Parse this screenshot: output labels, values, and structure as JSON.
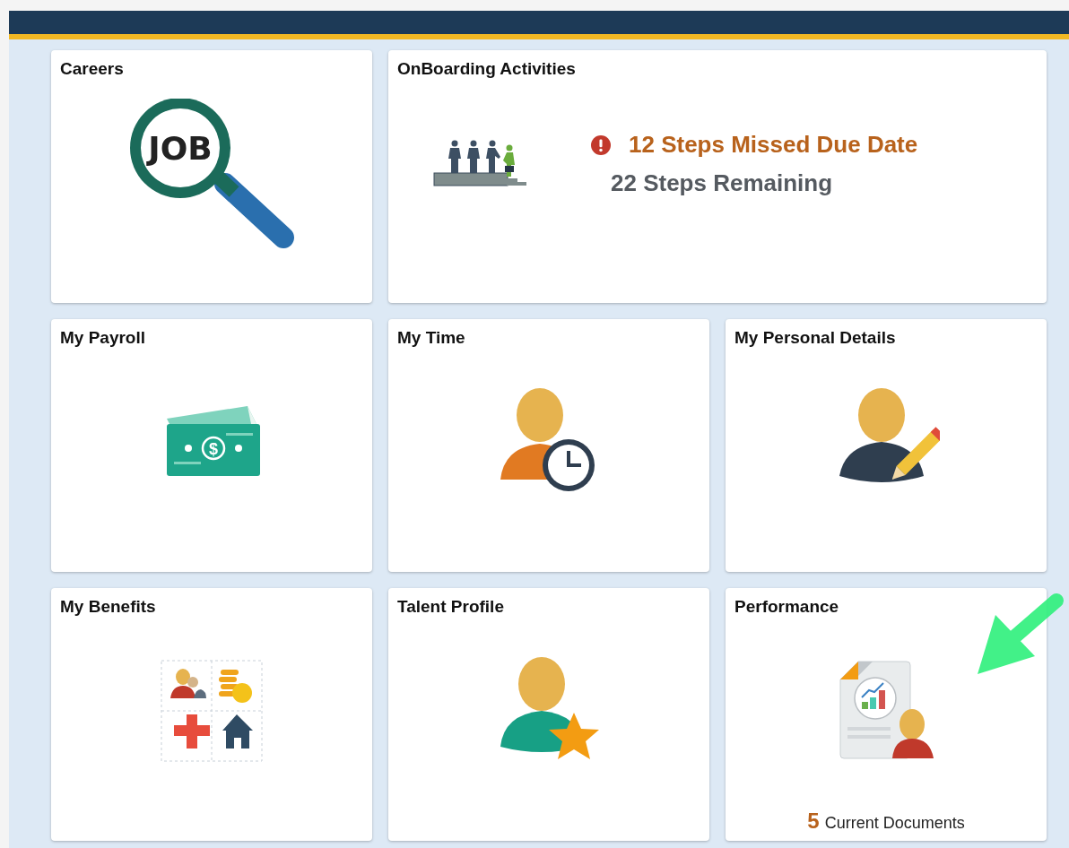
{
  "tiles": [
    {
      "title": "Careers",
      "kind": "job",
      "icon_text": "JOB"
    },
    {
      "title": "OnBoarding Activities",
      "kind": "onboarding",
      "alerts": [
        {
          "text": "12 Steps Missed Due Date",
          "kind": "warning"
        },
        {
          "text": "22 Steps Remaining",
          "kind": "info"
        }
      ]
    },
    {
      "title": "My Payroll",
      "kind": "payroll",
      "icon_text": "$"
    },
    {
      "title": "My Time",
      "kind": "time"
    },
    {
      "title": "My Personal Details",
      "kind": "personal"
    },
    {
      "title": "My Benefits",
      "kind": "benefits"
    },
    {
      "title": "Talent Profile",
      "kind": "talent"
    },
    {
      "title": "Performance",
      "kind": "performance",
      "count": "5",
      "count_label": "Current Documents"
    }
  ]
}
